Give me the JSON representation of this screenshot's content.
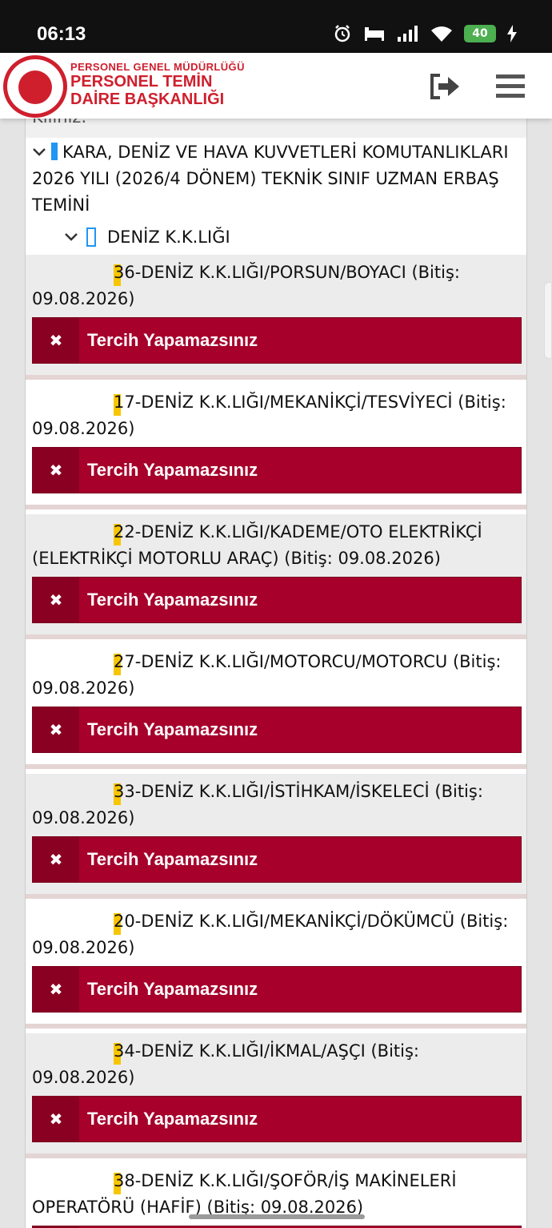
{
  "status_bar": {
    "time": "06:13",
    "battery": "40"
  },
  "header": {
    "logo_line1": "PERSONEL GENEL MÜDÜRLÜĞÜ",
    "logo_line2": "PERSONEL TEMİN",
    "logo_line3": "DAİRE BAŞKANLIĞI"
  },
  "tree": {
    "top_clipped_text": "Kılınız.",
    "root_label": "KARA, DENİZ VE HAVA KUVVETLERİ KOMUTANLIKLARI 2026 YILI (2026/4 DÖNEM) TEKNİK SINIF UZMAN ERBAŞ TEMİNİ",
    "child_label": "DENİZ K.K.LIĞI"
  },
  "button_label": "Tercih Yapamazsınız",
  "button_icon": "✖",
  "items": [
    {
      "title": "36-DENİZ K.K.LIĞI/PORSUN/BOYACI (Bitiş: 09.08.2026)"
    },
    {
      "title": "17-DENİZ K.K.LIĞI/MEKANİKÇİ/TESVİYECİ (Bitiş: 09.08.2026)"
    },
    {
      "title": "22-DENİZ K.K.LIĞI/KADEME/OTO ELEKTRİKÇİ (ELEKTRİKÇİ MOTORLU ARAÇ) (Bitiş: 09.08.2026)"
    },
    {
      "title": "27-DENİZ K.K.LIĞI/MOTORCU/MOTORCU (Bitiş: 09.08.2026)"
    },
    {
      "title": "33-DENİZ K.K.LIĞI/İSTİHKAM/İSKELECİ (Bitiş: 09.08.2026)"
    },
    {
      "title": "20-DENİZ K.K.LIĞI/MEKANİKÇİ/DÖKÜMCÜ (Bitiş: 09.08.2026)"
    },
    {
      "title": "34-DENİZ K.K.LIĞI/İKMAL/AŞÇI (Bitiş: 09.08.2026)"
    },
    {
      "title": "38-DENİZ K.K.LIĞI/ŞOFÖR/İŞ MAKİNELERİ OPERATÖRÜ (HAFİF) (Bitiş: 09.08.2026)"
    }
  ],
  "colors": {
    "button": "#a6002b",
    "warning_mark": "#f7c600",
    "tree_marker": "#2196f3"
  }
}
